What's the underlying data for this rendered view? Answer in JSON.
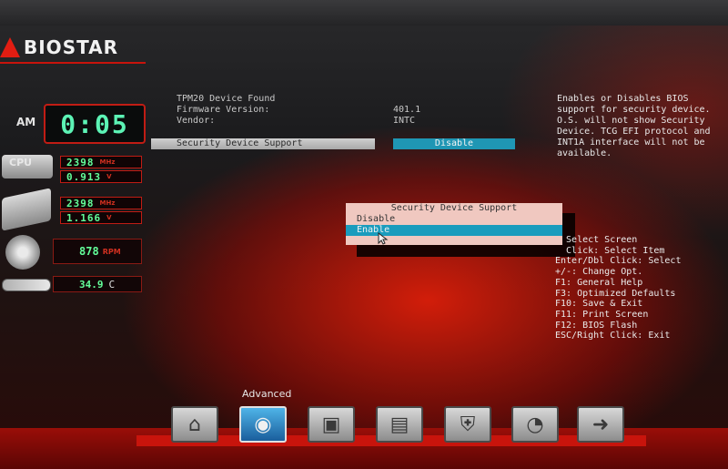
{
  "brand": {
    "name": "BIOSTAR",
    "accent": "#e21d12"
  },
  "status": {
    "clock_period": "AM",
    "clock_time": "0:05",
    "cpu": {
      "label": "CPU",
      "freq": "2398",
      "freq_unit": "MHz",
      "volt": "0.913",
      "volt_unit": "V"
    },
    "mem": {
      "freq": "2398",
      "freq_unit": "MHz",
      "volt": "1.166",
      "volt_unit": "V"
    },
    "fan": {
      "value": "878",
      "unit": "RPM"
    },
    "temp": {
      "value": "34.9",
      "unit": "C"
    }
  },
  "info": {
    "tpm_found": "TPM20 Device Found",
    "firmware_label": "Firmware Version:",
    "firmware_value": "401.1",
    "vendor_label": "Vendor:",
    "vendor_value": "INTC",
    "setting_label": "Security Device Support",
    "setting_value": "Disable"
  },
  "popup": {
    "title": "Security Device Support",
    "options": [
      "Disable",
      "Enable"
    ],
    "selected": "Enable"
  },
  "help": {
    "description": "Enables or Disables BIOS support for security device. O.S. will not show Security Device. TCG EFI protocol and INT1A interface will not be available.",
    "keys": [
      "  Select Screen",
      "  Click: Select Item",
      "Enter/Dbl Click: Select",
      "+/-: Change Opt.",
      "F1: General Help",
      "F3: Optimized Defaults",
      "F10: Save & Exit",
      "F11: Print Screen",
      "F12: BIOS Flash",
      "ESC/Right Click: Exit"
    ]
  },
  "nav": {
    "active_label": "Advanced",
    "items": [
      {
        "icon": "home-icon"
      },
      {
        "icon": "advanced-icon"
      },
      {
        "icon": "chipset-icon"
      },
      {
        "icon": "storage-icon"
      },
      {
        "icon": "security-icon"
      },
      {
        "icon": "performance-icon"
      },
      {
        "icon": "exit-icon"
      }
    ]
  }
}
